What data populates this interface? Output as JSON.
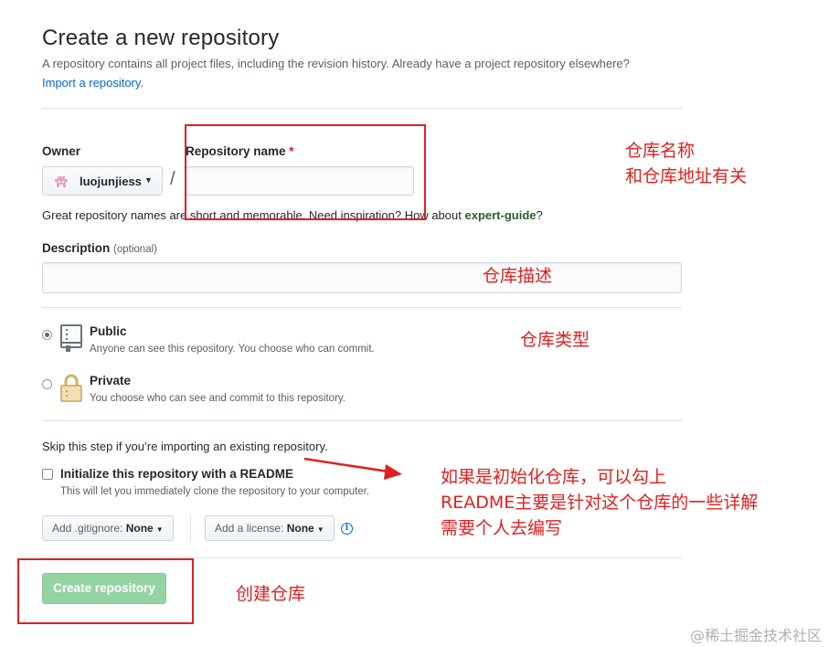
{
  "header": {
    "title": "Create a new repository",
    "subtitle": "A repository contains all project files, including the revision history. Already have a project repository elsewhere?",
    "import_link": "Import a repository."
  },
  "owner": {
    "label": "Owner",
    "value": "luojunjiess",
    "avatar_icon": "identicon"
  },
  "repo_name": {
    "label": "Repository name",
    "required_marker": "*",
    "value": "",
    "separator": "/"
  },
  "hint": {
    "text_before": "Great repository names are short and memorable. Need inspiration? How about",
    "suggestion": "expert-guide",
    "text_after": "?"
  },
  "description": {
    "label": "Description",
    "optional": "(optional)",
    "value": ""
  },
  "visibility": {
    "options": [
      {
        "title": "Public",
        "desc": "Anyone can see this repository. You choose who can commit.",
        "selected": true,
        "icon": "repo-book-icon"
      },
      {
        "title": "Private",
        "desc": "You choose who can see and commit to this repository.",
        "selected": false,
        "icon": "lock-icon"
      }
    ]
  },
  "init": {
    "skip_text": "Skip this step if you’re importing an existing repository.",
    "readme_label": "Initialize this repository with a README",
    "readme_desc": "This will let you immediately clone the repository to your computer.",
    "readme_checked": false
  },
  "dropdowns": {
    "gitignore_prefix": "Add .gitignore:",
    "gitignore_value": "None",
    "license_prefix": "Add a license:",
    "license_value": "None"
  },
  "submit": {
    "label": "Create repository",
    "enabled": false,
    "color": "#94d3a2"
  },
  "annotations": {
    "repo_name_line1": "仓库名称",
    "repo_name_line2": "和仓库地址有关",
    "description": "仓库描述",
    "type": "仓库类型",
    "readme_line1": "如果是初始化仓库，可以勾上",
    "readme_line2": "README主要是针对这个仓库的一些详解",
    "readme_line3": "需要个人去编写",
    "create": "创建仓库",
    "color": "#e02020"
  },
  "watermark": "@稀土掘金技术社区"
}
